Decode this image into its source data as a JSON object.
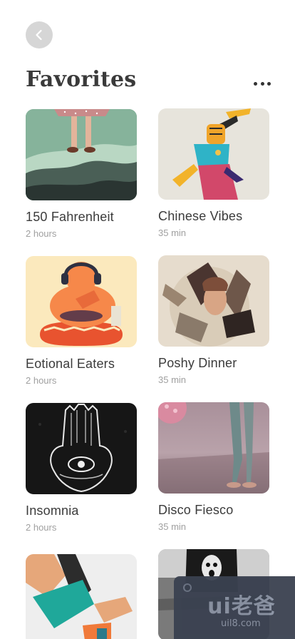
{
  "header": {
    "back_icon": "chevron-left-icon",
    "title": "Favorites",
    "more_icon": "more-horizontal-icon"
  },
  "items": [
    {
      "title": "150 Fahrenheit",
      "duration": "2 hours"
    },
    {
      "title": "Chinese Vibes",
      "duration": "35 min"
    },
    {
      "title": "Eotional Eaters",
      "duration": "2 hours"
    },
    {
      "title": "Poshy Dinner",
      "duration": "35 min"
    },
    {
      "title": "Insomnia",
      "duration": "2 hours"
    },
    {
      "title": "Disco Fiesco",
      "duration": "35 min"
    },
    {
      "title": "",
      "duration": ""
    },
    {
      "title": "",
      "duration": ""
    }
  ],
  "watermark": {
    "text": "ui老爸",
    "sub": "uil8.com"
  },
  "colors": {
    "back_button_bg": "#d6d6d6",
    "title": "#3a3a3a",
    "subtitle": "#a0a0a0"
  }
}
